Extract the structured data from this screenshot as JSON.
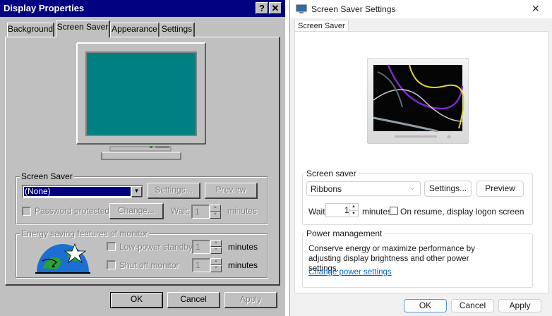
{
  "left_dialog": {
    "title": "Display Properties",
    "help_button": "?",
    "close_button": "✕",
    "tabs": [
      "Background",
      "Screen Saver",
      "Appearance",
      "Settings"
    ],
    "active_tab": "Screen Saver",
    "screen_saver_group": {
      "label": "Screen Saver",
      "selected": "(None)",
      "settings_button": "Settings...",
      "preview_button": "Preview",
      "password_label": "Password protected",
      "change_button": "Change...",
      "wait_label": "Wait:",
      "wait_value": "1",
      "minutes_label": "minutes"
    },
    "energy_group": {
      "label": "Energy saving features of monitor",
      "low_power_label": "Low-power standby",
      "low_power_value": "1",
      "shut_off_label": "Shut off monitor",
      "shut_off_value": "1",
      "minutes_label": "minutes"
    },
    "buttons": {
      "ok": "OK",
      "cancel": "Cancel",
      "apply": "Apply"
    },
    "colors": {
      "titlebar": "#000080",
      "face": "#c0c0c0",
      "preview_screen": "#008080"
    }
  },
  "right_dialog": {
    "title": "Screen Saver Settings",
    "close_button": "✕",
    "tab": "Screen Saver",
    "screen_saver_group": {
      "label": "Screen saver",
      "selected": "Ribbons",
      "settings_button": "Settings...",
      "preview_button": "Preview",
      "wait_label": "Wait:",
      "wait_value": "1",
      "minutes_label": "minutes",
      "resume_label": "On resume, display logon screen"
    },
    "power_group": {
      "label": "Power management",
      "description": "Conserve energy or maximize performance by adjusting display brightness and other power settings.",
      "link": "Change power settings"
    },
    "buttons": {
      "ok": "OK",
      "cancel": "Cancel",
      "apply": "Apply"
    }
  }
}
